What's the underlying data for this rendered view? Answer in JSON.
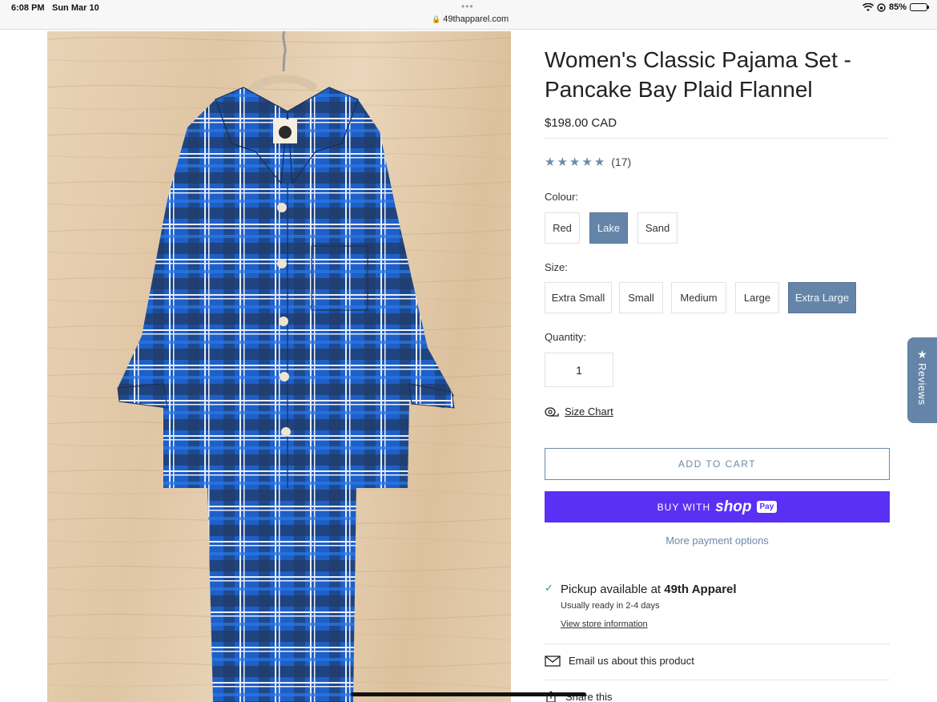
{
  "status_bar": {
    "time": "6:08 PM",
    "date": "Sun Mar 10",
    "tab_dots": "•••",
    "url": "49thapparel.com",
    "battery": "85%"
  },
  "product": {
    "image_alt": "",
    "title": "Women's Classic Pajama Set - Pancake Bay Plaid Flannel",
    "price": "$198.00 CAD",
    "rating_stars": 5,
    "rating_count": "(17)"
  },
  "colour": {
    "label": "Colour:",
    "options": [
      "Red",
      "Lake",
      "Sand"
    ],
    "selected": "Lake"
  },
  "size": {
    "label": "Size:",
    "options": [
      "Extra Small",
      "Small",
      "Medium",
      "Large",
      "Extra Large"
    ],
    "selected": "Extra Large"
  },
  "quantity": {
    "label": "Quantity:",
    "value": "1"
  },
  "size_chart_link": "Size Chart",
  "buttons": {
    "add_to_cart": "ADD TO CART",
    "buy_with": "BUY WITH",
    "shop_brand": "shop",
    "shop_pay": "Pay",
    "more_payment": "More payment options"
  },
  "pickup": {
    "text_prefix": "Pickup available at",
    "store": "49th Apparel",
    "ready": "Usually ready in 2-4 days",
    "store_info_link": "View store information"
  },
  "email_product": "Email us about this product",
  "share": "Share this",
  "reviews_tab": "Reviews",
  "colors": {
    "accent": "#6585a8",
    "shop_pay": "#5a31f4",
    "pickup_check": "#2e9e4a"
  }
}
